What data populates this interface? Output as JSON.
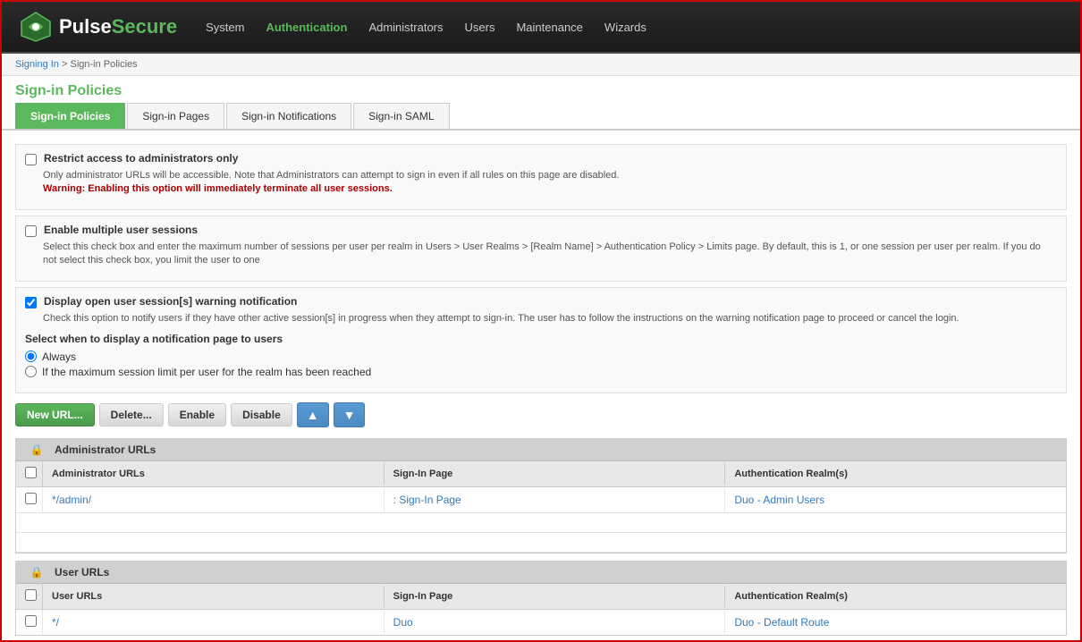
{
  "header": {
    "logo_pulse": "Pulse",
    "logo_secure": "Secure",
    "nav_items": [
      {
        "label": "System",
        "active": false
      },
      {
        "label": "Authentication",
        "active": true
      },
      {
        "label": "Administrators",
        "active": false
      },
      {
        "label": "Users",
        "active": false
      },
      {
        "label": "Maintenance",
        "active": false
      },
      {
        "label": "Wizards",
        "active": false
      }
    ]
  },
  "breadcrumb": {
    "link_text": "Signing In",
    "separator": " > ",
    "current": "Sign-in Policies"
  },
  "page_title": "Sign-in Policies",
  "tabs": [
    {
      "label": "Sign-in Policies",
      "active": true
    },
    {
      "label": "Sign-in Pages",
      "active": false
    },
    {
      "label": "Sign-in Notifications",
      "active": false
    },
    {
      "label": "Sign-in SAML",
      "active": false
    }
  ],
  "checkboxes": [
    {
      "id": "chk1",
      "label": "Restrict access to administrators only",
      "checked": false,
      "description": "Only administrator URLs will be accessible. Note that Administrators can attempt to sign in even if all rules on this page are disabled.",
      "warning": "Warning: Enabling this option will immediately terminate all user sessions."
    },
    {
      "id": "chk2",
      "label": "Enable multiple user sessions",
      "checked": false,
      "description": "Select this check box and enter the maximum number of sessions per user per realm in Users > User Realms > [Realm Name] > Authentication Policy > Limits page. By default, this is 1, or one session per user per realm. If you do not select this check box, you limit the user to one"
    },
    {
      "id": "chk3",
      "label": "Display open user session[s] warning notification",
      "checked": true,
      "description": "Check this option to notify users if they have other active session[s] in progress when they attempt to sign-in. The user has to follow the instructions on the warning notification page to proceed or cancel the login."
    }
  ],
  "radio_section": {
    "label": "Select when to display a notification page to users",
    "options": [
      {
        "id": "r1",
        "label": "Always",
        "checked": true
      },
      {
        "id": "r2",
        "label": "If the maximum session limit per user for the realm has been reached",
        "checked": false
      }
    ]
  },
  "buttons": [
    {
      "label": "New URL...",
      "type": "primary"
    },
    {
      "label": "Delete...",
      "type": "default"
    },
    {
      "label": "Enable",
      "type": "default"
    },
    {
      "label": "Disable",
      "type": "default"
    },
    {
      "label": "▲",
      "type": "arrow"
    },
    {
      "label": "▼",
      "type": "arrow"
    }
  ],
  "admin_table": {
    "section_label": "Administrator URLs",
    "columns": [
      "",
      "Administrator URLs",
      "Sign-In Page",
      "Authentication Realm(s)"
    ],
    "rows": [
      {
        "url": "*/admin/",
        "signin_page": ": Sign-In Page",
        "realm": "Duo - Admin Users"
      }
    ]
  },
  "user_table": {
    "section_label": "User URLs",
    "columns": [
      "",
      "User URLs",
      "Sign-In Page",
      "Authentication Realm(s)"
    ],
    "rows": [
      {
        "url": "*/",
        "signin_page": "Duo",
        "realm": "Duo - Default Route"
      }
    ]
  }
}
